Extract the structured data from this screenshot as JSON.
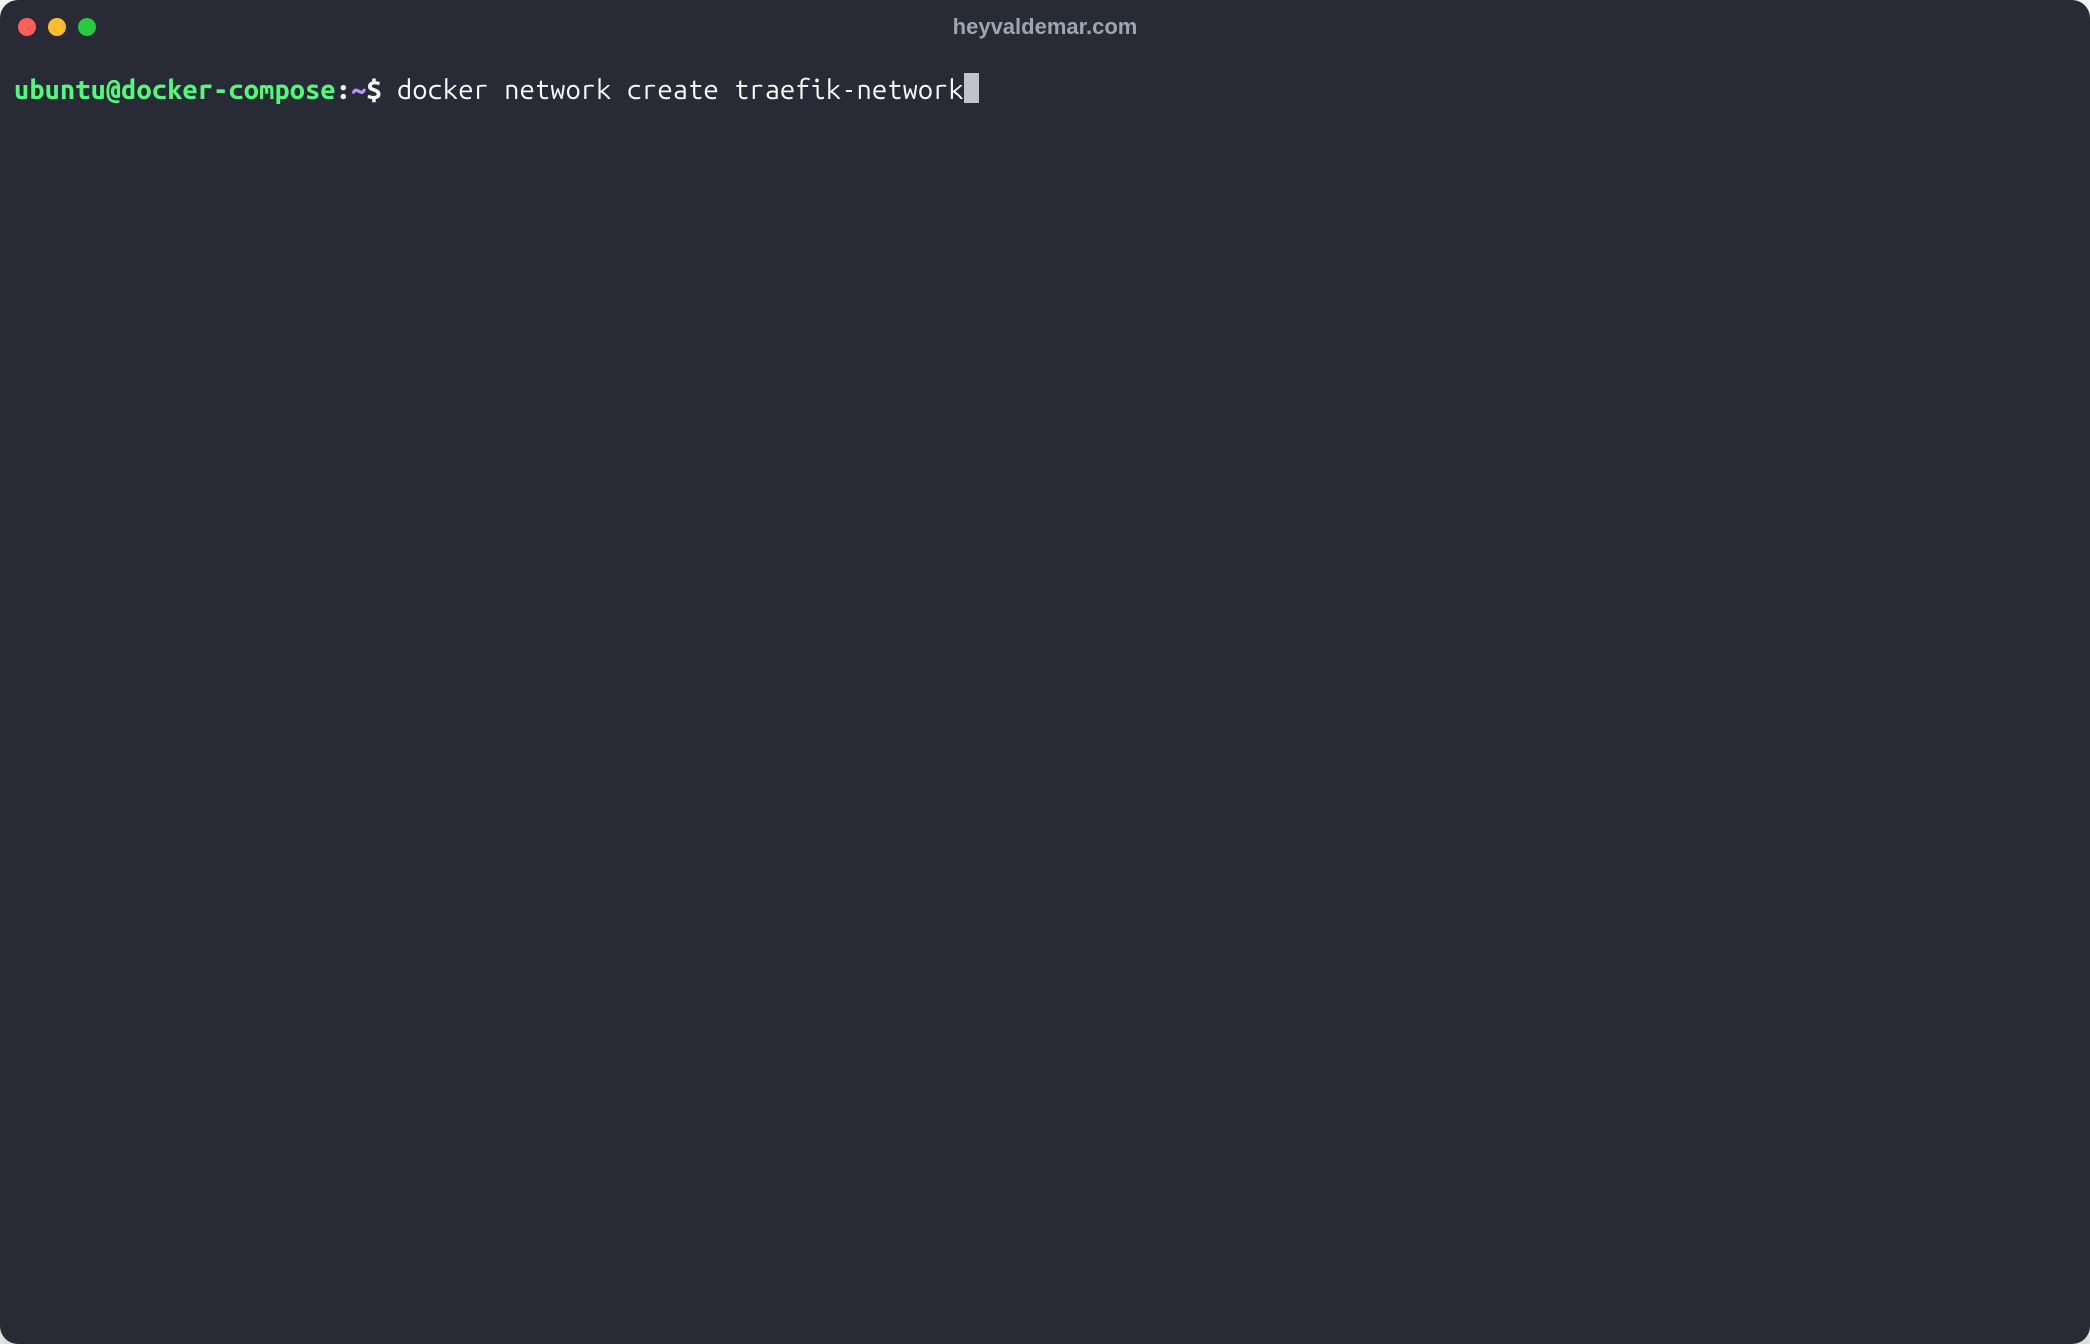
{
  "titlebar": {
    "title": "heyvaldemar.com"
  },
  "prompt": {
    "user_host": "ubuntu@docker-compose",
    "separator": ":",
    "path": "~",
    "symbol": "$"
  },
  "command": "docker network create traefik-network",
  "colors": {
    "background": "#282a36",
    "text": "#f8f8f2",
    "prompt_user": "#50fa7b",
    "prompt_path": "#bd93f9",
    "cursor": "#c0c2cc",
    "title": "#a0a3b1",
    "close": "#ff5f56",
    "minimize": "#ffbd2e",
    "maximize": "#27c93f"
  }
}
